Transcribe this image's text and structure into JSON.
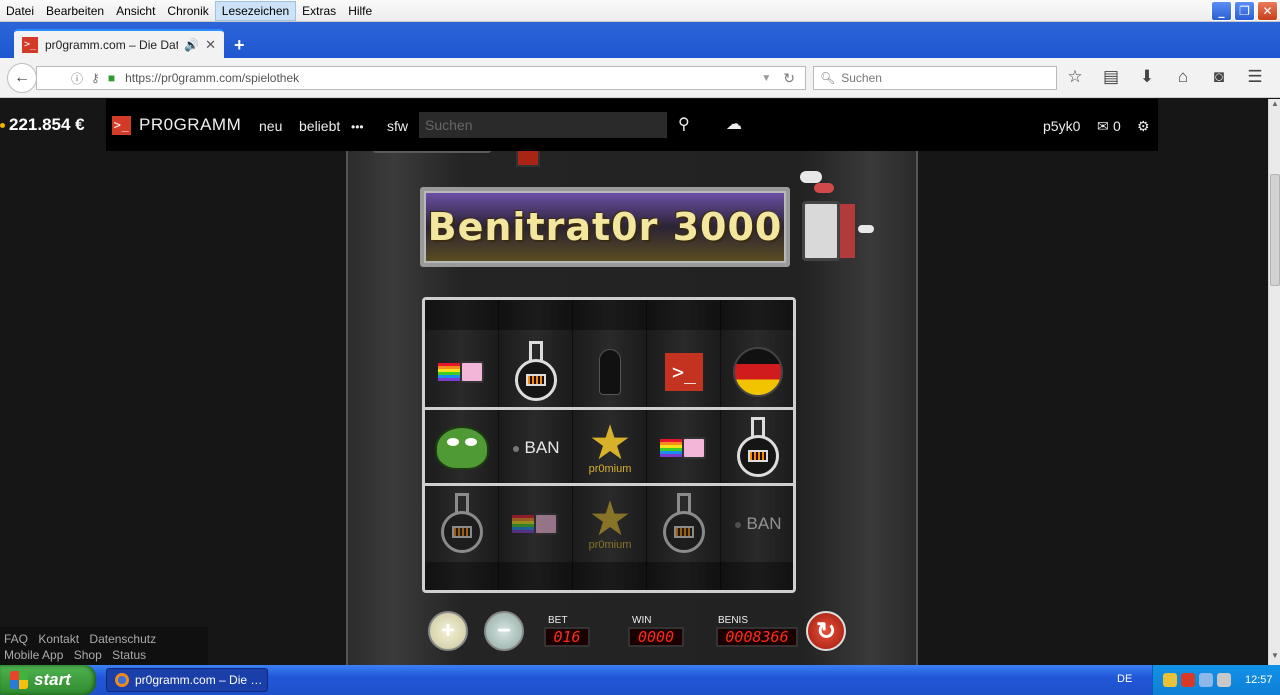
{
  "menu": [
    "Datei",
    "Bearbeiten",
    "Ansicht",
    "Chronik",
    "Lesezeichen",
    "Extras",
    "Hilfe"
  ],
  "menu_active_index": 4,
  "window_buttons": {
    "minimize": "_",
    "maximize": "❐",
    "close": "✕"
  },
  "tab": {
    "favicon": ">_",
    "title": "pr0gramm.com – Die Dati…",
    "audio_icon": "speaker-icon",
    "close": "✕",
    "new_tab": "+"
  },
  "addressbar": {
    "url": "https://pr0gramm.com/spielothek",
    "search_placeholder": "Suchen"
  },
  "toolbar_icons": [
    "bookmark-star-icon",
    "reading-list-icon",
    "download-icon",
    "home-icon",
    "pocket-icon",
    "menu-icon"
  ],
  "page": {
    "score": "221.854 €",
    "logo": "PR0GRAMM",
    "logo_mark": ">_",
    "nav": {
      "new": "neu",
      "popular": "beliebt",
      "more": "•••",
      "sfw": "sfw"
    },
    "search_placeholder": "Suchen",
    "user": "p5yk0",
    "messages": "0"
  },
  "slot": {
    "title": "Benitrat0r 3000",
    "rows": [
      [
        "nyan",
        "flask",
        "plug",
        "logo",
        "ball"
      ],
      [
        "frog",
        "ban",
        "star",
        "nyan",
        "flask"
      ],
      [
        "flask",
        "nyan",
        "star",
        "flask",
        "ban"
      ]
    ],
    "ban_label": "BAN",
    "star_label": "pr0mium",
    "logo_glyph": ">_",
    "bet_label": "BET",
    "bet_value": "016",
    "win_label": "WIN",
    "win_value": "0000",
    "benis_label": "BENIS",
    "benis_value": "0008366",
    "plus": "+",
    "minus": "−",
    "spin": "↻"
  },
  "footer": {
    "row1": [
      "FAQ",
      "Kontakt",
      "Datenschutz"
    ],
    "row2": [
      "Mobile App",
      "Shop",
      "Status"
    ]
  },
  "taskbar": {
    "start": "start",
    "item": "pr0gramm.com – Die …",
    "lang": "DE",
    "clock": "12:57"
  }
}
